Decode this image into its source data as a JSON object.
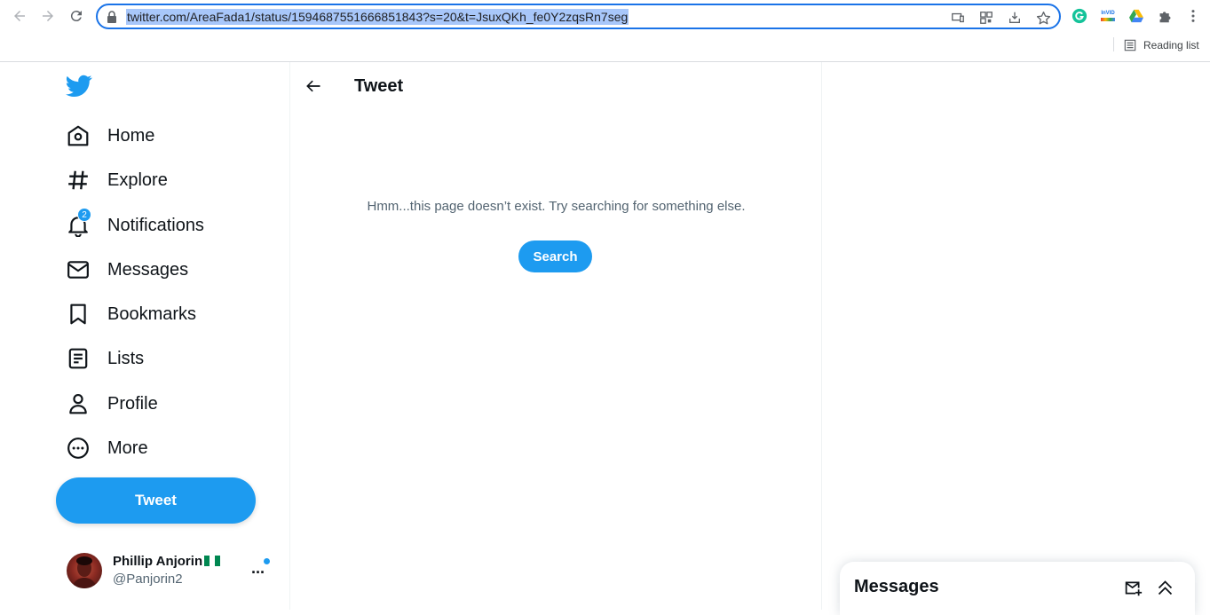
{
  "browser": {
    "url": "twitter.com/AreaFada1/status/1594687551666851843?s=20&t=JsuxQKh_fe0Y2zqsRn7seg",
    "reading_list_label": "Reading list",
    "extension_invid_label": "InVID"
  },
  "sidebar": {
    "items": [
      {
        "label": "Home"
      },
      {
        "label": "Explore"
      },
      {
        "label": "Notifications",
        "badge": "2"
      },
      {
        "label": "Messages"
      },
      {
        "label": "Bookmarks"
      },
      {
        "label": "Lists"
      },
      {
        "label": "Profile"
      },
      {
        "label": "More"
      }
    ],
    "tweet_button": "Tweet"
  },
  "account": {
    "name": "Phillip Anjorin",
    "handle": "@Panjorin2",
    "more": "···"
  },
  "main": {
    "title": "Tweet",
    "message": "Hmm...this page doesn’t exist. Try searching for something else.",
    "search_button": "Search"
  },
  "messages_drawer": {
    "title": "Messages"
  },
  "colors": {
    "accent": "#1d9bf0",
    "text": "#0f1419",
    "secondary_text": "#536471",
    "url_selection": "#a8c7fa"
  }
}
